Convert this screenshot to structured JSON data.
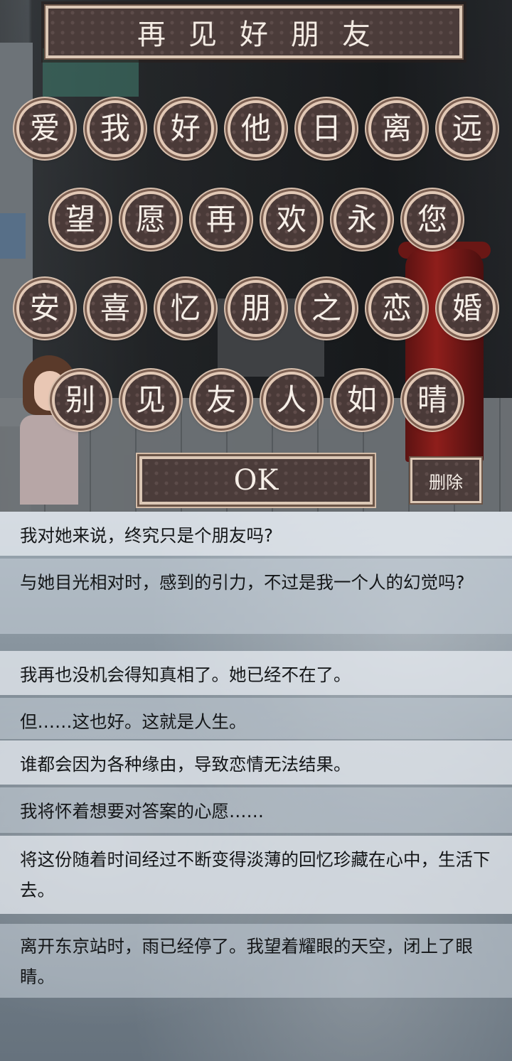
{
  "puzzle": {
    "banner": "再见好朋友",
    "rows": [
      [
        "爱",
        "我",
        "好",
        "他",
        "日",
        "离",
        "远"
      ],
      [
        "望",
        "愿",
        "再",
        "欢",
        "永",
        "您"
      ],
      [
        "安",
        "喜",
        "忆",
        "朋",
        "之",
        "恋",
        "婚"
      ],
      [
        "别",
        "见",
        "友",
        "人",
        "如",
        "晴"
      ]
    ],
    "ok_label": "OK",
    "delete_label": "删除"
  },
  "log": [
    "我对她来说，终究只是个朋友吗?",
    "与她目光相对时，感到的引力，不过是我一个人的幻觉吗?",
    "我再也没机会得知真相了。她已经不在了。",
    "但……这也好。这就是人生。",
    "谁都会因为各种缘由，导致恋情无法结果。",
    "我将怀着想要对答案的心愿……",
    "将这份随着时间经过不断变得淡薄的回忆珍藏在心中，生活下去。",
    "离开东京站时，雨已经停了。我望着耀眼的天空，闭上了眼睛。"
  ]
}
